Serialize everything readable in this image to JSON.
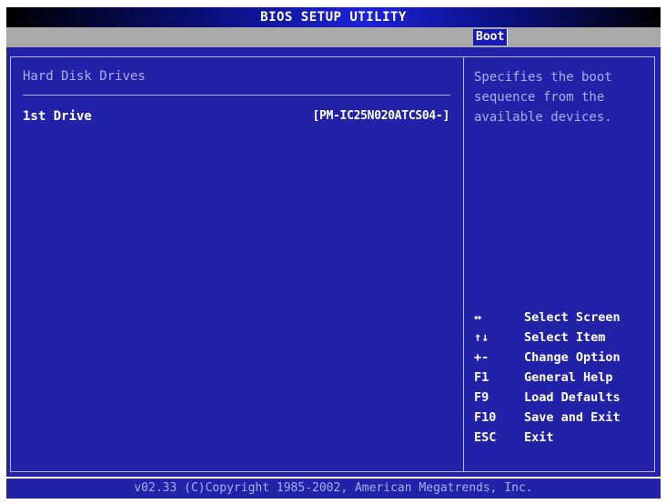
{
  "title_bar": {
    "title": "BIOS SETUP UTILITY"
  },
  "menu": {
    "tabs": [
      {
        "label": "Boot",
        "selected": true
      }
    ]
  },
  "main": {
    "section_title": "Hard Disk Drives",
    "items": [
      {
        "label": "1st Drive",
        "value": "[PM-IC25N020ATCS04-]"
      }
    ]
  },
  "help": {
    "lines": [
      "Specifies the boot",
      "sequence from the",
      "available devices."
    ]
  },
  "keys": [
    {
      "key": "↔",
      "desc": "Select Screen"
    },
    {
      "key": "↑↓",
      "desc": "Select Item"
    },
    {
      "key": "+-",
      "desc": "Change Option"
    },
    {
      "key": "F1",
      "desc": "General Help"
    },
    {
      "key": "F9",
      "desc": "Load Defaults"
    },
    {
      "key": "F10",
      "desc": "Save and Exit"
    },
    {
      "key": "ESC",
      "desc": "Exit"
    }
  ],
  "footer": {
    "text": "v02.33 (C)Copyright 1985-2002, American Megatrends, Inc."
  },
  "colors": {
    "panel_blue": "#2222a8",
    "menu_gray": "#a9a9a9",
    "help_text": "#a8aef0",
    "highlight_text": "#ffffff"
  }
}
